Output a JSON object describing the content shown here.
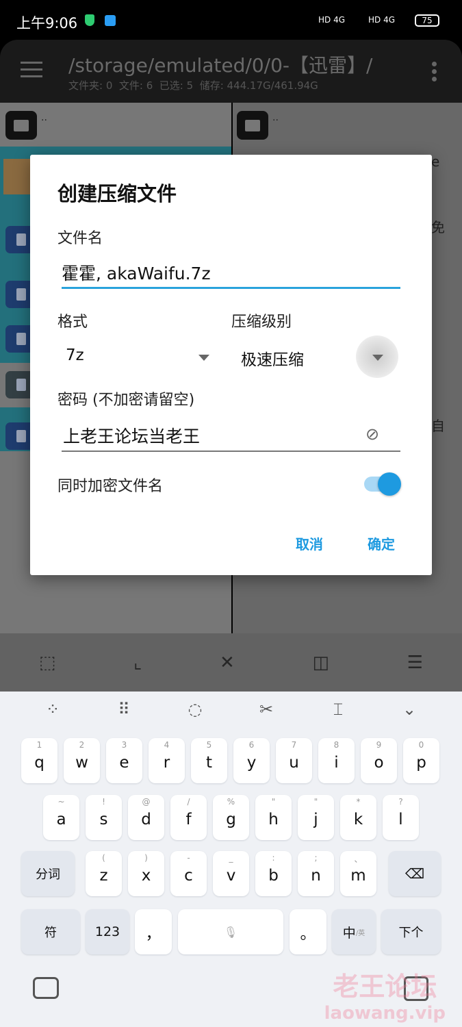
{
  "status_bar": {
    "time": "上午9:06",
    "net1": "HD 4G",
    "net2": "HD 4G",
    "battery": "75"
  },
  "app_bar": {
    "path": "/storage/emulated/0/0-【迅雷】/",
    "info": "文件夹: 0  文件: 6  已选: 5  储存: 444.17G/461.94G"
  },
  "left_pane": {
    "parent": ".."
  },
  "right_pane": {
    "parent": "..",
    "fragments": [
      "e",
      "免",
      "自"
    ]
  },
  "dialog": {
    "title": "创建压缩文件",
    "filename_label": "文件名",
    "filename_value": "霍霍, akaWaifu.7z",
    "format_label": "格式",
    "format_value": "7z",
    "level_label": "压缩级别",
    "level_value": "极速压缩",
    "password_label": "密码 (不加密请留空)",
    "password_value": "上老王论坛当老王",
    "encrypt_names_label": "同时加密文件名",
    "encrypt_names_on": true,
    "cancel": "取消",
    "ok": "确定",
    "accent": "#1e9ae0"
  },
  "bottom_toolbar": [
    "select-all-icon",
    "select-range-icon",
    "close-icon",
    "invert-selection-icon",
    "select-list-icon"
  ],
  "keyboard": {
    "row1": [
      [
        "q",
        "1"
      ],
      [
        "w",
        "2"
      ],
      [
        "e",
        "3"
      ],
      [
        "r",
        "4"
      ],
      [
        "t",
        "5"
      ],
      [
        "y",
        "6"
      ],
      [
        "u",
        "7"
      ],
      [
        "i",
        "8"
      ],
      [
        "o",
        "9"
      ],
      [
        "p",
        "0"
      ]
    ],
    "row2": [
      [
        "a",
        "~"
      ],
      [
        "s",
        "!"
      ],
      [
        "d",
        "@"
      ],
      [
        "f",
        "/"
      ],
      [
        "g",
        "%"
      ],
      [
        "h",
        "\""
      ],
      [
        "j",
        "\""
      ],
      [
        "k",
        "*"
      ],
      [
        "l",
        "?"
      ]
    ],
    "row3": [
      [
        "z",
        "("
      ],
      [
        "x",
        ")"
      ],
      [
        "c",
        "-"
      ],
      [
        "v",
        "_"
      ],
      [
        "b",
        ":"
      ],
      [
        "n",
        ";"
      ],
      [
        "m",
        "、"
      ]
    ],
    "segment": "分词",
    "symbols": "符",
    "numbers": "123",
    "comma": "，",
    "period": "。",
    "lang": "中",
    "lang_alt": "/英",
    "next": "下个"
  },
  "watermark": {
    "cn": "老王论坛",
    "url": "laowang.vip"
  }
}
